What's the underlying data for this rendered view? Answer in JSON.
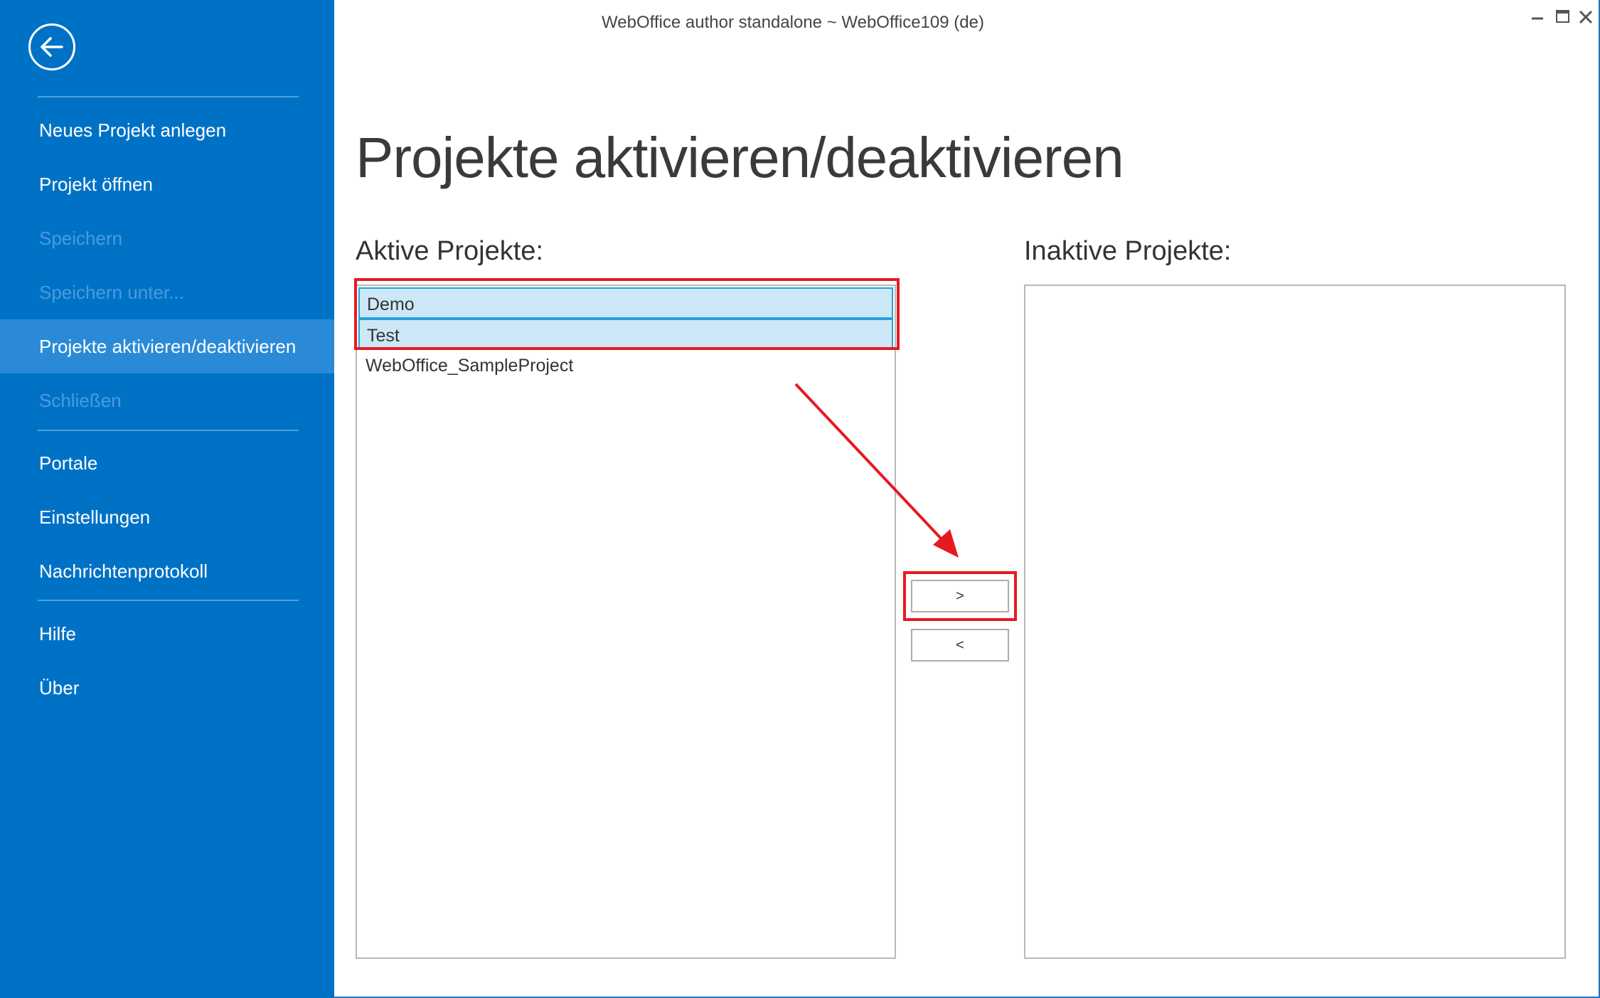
{
  "window": {
    "title": "WebOffice author standalone ~ WebOffice109 (de)"
  },
  "sidebar": {
    "back_icon": "back-arrow-icon",
    "items": [
      {
        "label": "Neues Projekt anlegen",
        "disabled": false
      },
      {
        "label": "Projekt öffnen",
        "disabled": false
      },
      {
        "label": "Speichern",
        "disabled": true
      },
      {
        "label": "Speichern unter...",
        "disabled": true
      },
      {
        "label": "Projekte aktivieren/deaktivieren",
        "disabled": false,
        "active": true
      },
      {
        "label": "Schließen",
        "disabled": true
      },
      {
        "label": "Portale",
        "disabled": false
      },
      {
        "label": "Einstellungen",
        "disabled": false
      },
      {
        "label": "Nachrichtenprotokoll",
        "disabled": false
      },
      {
        "label": "Hilfe",
        "disabled": false
      },
      {
        "label": "Über",
        "disabled": false
      }
    ]
  },
  "main": {
    "title": "Projekte aktivieren/deaktivieren",
    "active_label": "Aktive Projekte:",
    "inactive_label": "Inaktive Projekte:",
    "active_projects": [
      {
        "name": "Demo",
        "selected": true
      },
      {
        "name": "Test",
        "selected": true
      },
      {
        "name": "WebOffice_SampleProject",
        "selected": false
      }
    ],
    "inactive_projects": [],
    "move_right_label": ">",
    "move_left_label": "<"
  },
  "colors": {
    "sidebar_bg": "#0072c6",
    "sidebar_active": "#2a8ad8",
    "selection_bg": "#cce8f6",
    "selection_border": "#28a0db",
    "annotation_red": "#e51a20"
  }
}
